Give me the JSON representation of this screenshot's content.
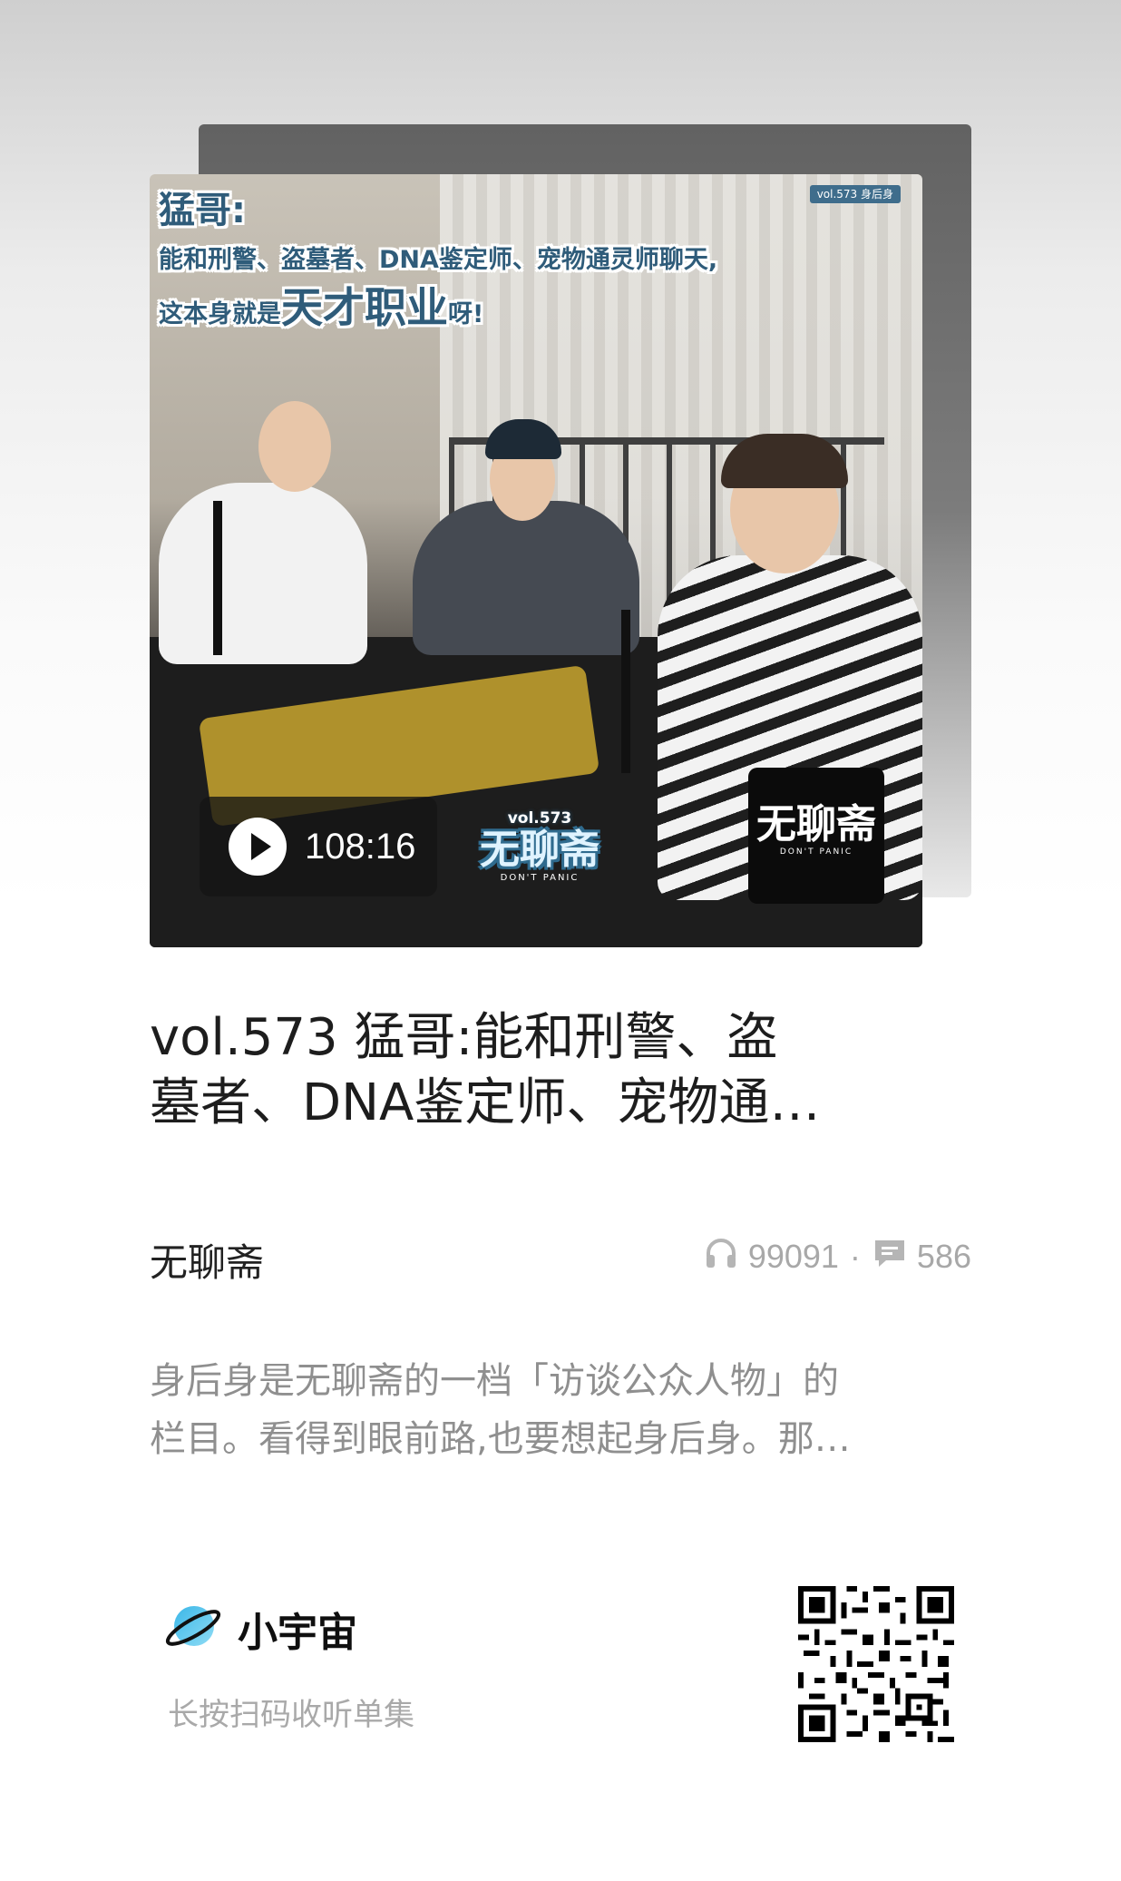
{
  "cover": {
    "headline_line1": "猛哥:",
    "headline_line2": "能和刑警、盗墓者、DNA鉴定师、宠物通灵师聊天,",
    "headline_line3_prefix": "这本身就是",
    "headline_line3_emphasis": "天才职业",
    "headline_line3_suffix": "呀!",
    "vol_tag": "vol.573 身后身",
    "duration": "108:16",
    "logo_vol": "vol.573",
    "logo_text": "无聊斋",
    "logo_sub": "DON'T PANIC",
    "brand_text": "无聊斋",
    "brand_sub": "DON'T PANIC"
  },
  "episode": {
    "title_line1": "vol.573 猛哥:能和刑警、盗",
    "title_line2": "墓者、DNA鉴定师、宠物通…",
    "podcast": "无聊斋",
    "plays": "99091",
    "separator": "·",
    "comments": "586",
    "description_line1": "身后身是无聊斋的一档「访谈公众人物」的",
    "description_line2": "栏目。看得到眼前路,也要想起身后身。那…"
  },
  "footer": {
    "app_name": "小宇宙",
    "scan_hint": "长按扫码收听单集"
  },
  "icons": {
    "plays": "headphones-icon",
    "comments": "comment-icon",
    "play": "play-icon",
    "app": "planet-icon"
  },
  "colors": {
    "headline": "#2f5c7a",
    "title": "#1d1d1d",
    "muted": "#a8a8a8"
  }
}
